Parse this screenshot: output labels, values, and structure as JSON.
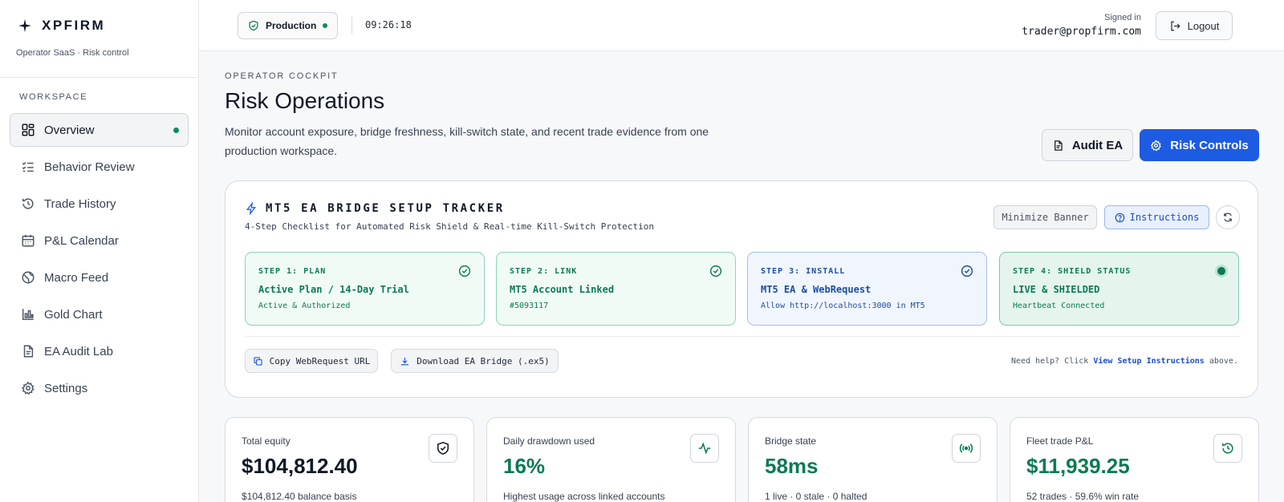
{
  "brand": {
    "name": "XPFIRM",
    "subtitle": "Operator SaaS · Risk control"
  },
  "sidebar": {
    "section_label": "WORKSPACE",
    "items": [
      {
        "label": "Overview",
        "icon": "grid-icon",
        "active": true
      },
      {
        "label": "Behavior Review",
        "icon": "checklist-icon"
      },
      {
        "label": "Trade History",
        "icon": "history-icon"
      },
      {
        "label": "P&L Calendar",
        "icon": "calendar-icon"
      },
      {
        "label": "Macro Feed",
        "icon": "globe-icon"
      },
      {
        "label": "Gold Chart",
        "icon": "bar-chart-icon"
      },
      {
        "label": "EA Audit Lab",
        "icon": "file-icon"
      },
      {
        "label": "Settings",
        "icon": "gear-icon"
      }
    ]
  },
  "topbar": {
    "environment": "Production",
    "clock": "09:26:18",
    "signed_in_label": "Signed in",
    "user_email": "trader@propfirm.com",
    "logout_label": "Logout"
  },
  "header": {
    "eyebrow": "OPERATOR COCKPIT",
    "title": "Risk Operations",
    "description": "Monitor account exposure, bridge freshness, kill-switch state, and recent trade evidence from one production workspace.",
    "audit_button": "Audit EA",
    "risk_button": "Risk Controls"
  },
  "tracker": {
    "title": "MT5 EA BRIDGE SETUP TRACKER",
    "subtitle": "4-Step Checklist for Automated Risk Shield & Real-time Kill-Switch Protection",
    "minimize_label": "Minimize Banner",
    "instructions_label": "Instructions",
    "steps": [
      {
        "label": "STEP 1: PLAN",
        "title": "Active Plan / 14-Day Trial",
        "note": "Active & Authorized"
      },
      {
        "label": "STEP 2: LINK",
        "title": "MT5 Account Linked",
        "note": "#5093117"
      },
      {
        "label": "STEP 3: INSTALL",
        "title": "MT5 EA & WebRequest",
        "note": "Allow http://localhost:3000 in MT5"
      },
      {
        "label": "STEP 4: SHIELD STATUS",
        "title": "LIVE & SHIELDED",
        "note": "Heartbeat Connected"
      }
    ],
    "copy_label": "Copy WebRequest URL",
    "download_label": "Download EA Bridge (.ex5)",
    "help_prefix": "Need help? Click",
    "help_link": "View Setup Instructions",
    "help_suffix": "above."
  },
  "stats": [
    {
      "label": "Total equity",
      "value": "$104,812.40",
      "foot": "$104,812.40 balance basis",
      "icon": "shield-icon",
      "color": "#111827"
    },
    {
      "label": "Daily drawdown used",
      "value": "16%",
      "foot": "Highest usage across linked accounts",
      "icon": "pulse-icon",
      "color": "#0c7a52"
    },
    {
      "label": "Bridge state",
      "value": "58ms",
      "foot": "1 live · 0 stale · 0 halted",
      "icon": "broadcast-icon",
      "color": "#0c7a52"
    },
    {
      "label": "Fleet trade P&L",
      "value": "$11,939.25",
      "foot": "52 trades · 59.6% win rate",
      "icon": "history-icon",
      "color": "#0c7a52"
    }
  ]
}
